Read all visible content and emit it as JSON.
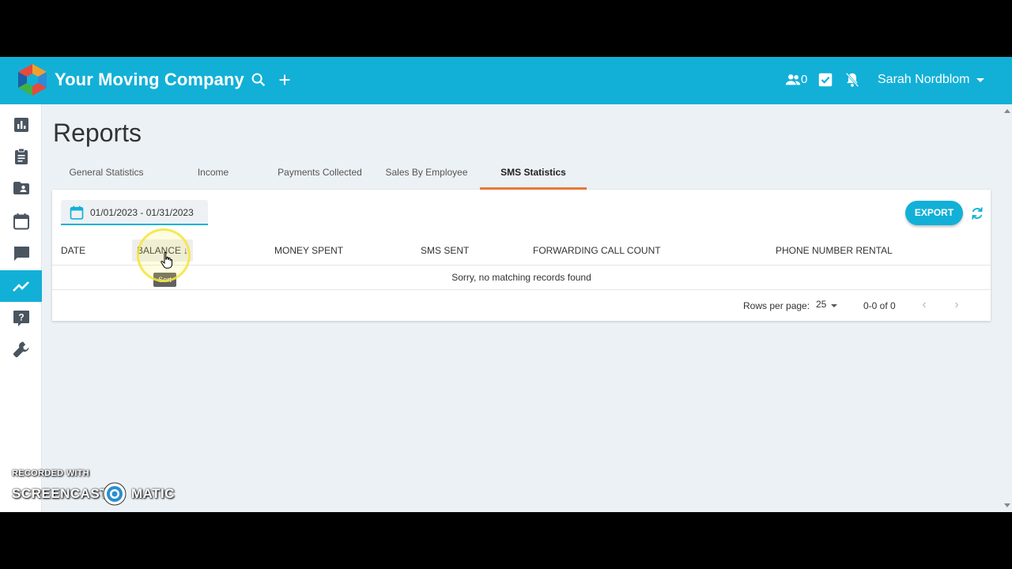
{
  "header": {
    "company_name": "Your Moving Company",
    "people_count": "0",
    "user_name": "Sarah Nordblom",
    "brand_color": "#12b0d7"
  },
  "sidebar": {
    "items": [
      {
        "icon": "bar-chart-icon"
      },
      {
        "icon": "clipboard-icon"
      },
      {
        "icon": "folder-user-icon"
      },
      {
        "icon": "calendar-icon"
      },
      {
        "icon": "chat-icon"
      },
      {
        "icon": "trending-icon",
        "active": true
      },
      {
        "icon": "help-icon"
      },
      {
        "icon": "wrench-icon"
      }
    ]
  },
  "page": {
    "title": "Reports",
    "tabs": [
      {
        "label": "General Statistics"
      },
      {
        "label": "Income"
      },
      {
        "label": "Payments Collected"
      },
      {
        "label": "Sales By Employee"
      },
      {
        "label": "SMS Statistics",
        "active": true
      }
    ],
    "active_tab_color": "#ec7a3a"
  },
  "toolbar": {
    "date_range": "01/01/2023 - 01/31/2023",
    "export_label": "EXPORT"
  },
  "table": {
    "columns": [
      "DATE",
      "BALANCE",
      "MONEY SPENT",
      "SMS SENT",
      "FORWARDING CALL COUNT",
      "PHONE NUMBER RENTAL"
    ],
    "sort_indicator": "↓",
    "empty_message": "Sorry, no matching records found",
    "rows_per_page_label": "Rows per page:",
    "rows_per_page_value": "25",
    "page_range": "0-0 of 0"
  },
  "tooltip": {
    "text": "Sort"
  },
  "watermark": {
    "line1": "RECORDED WITH",
    "left_word": "SCREENCAST",
    "right_word": "MATIC"
  }
}
